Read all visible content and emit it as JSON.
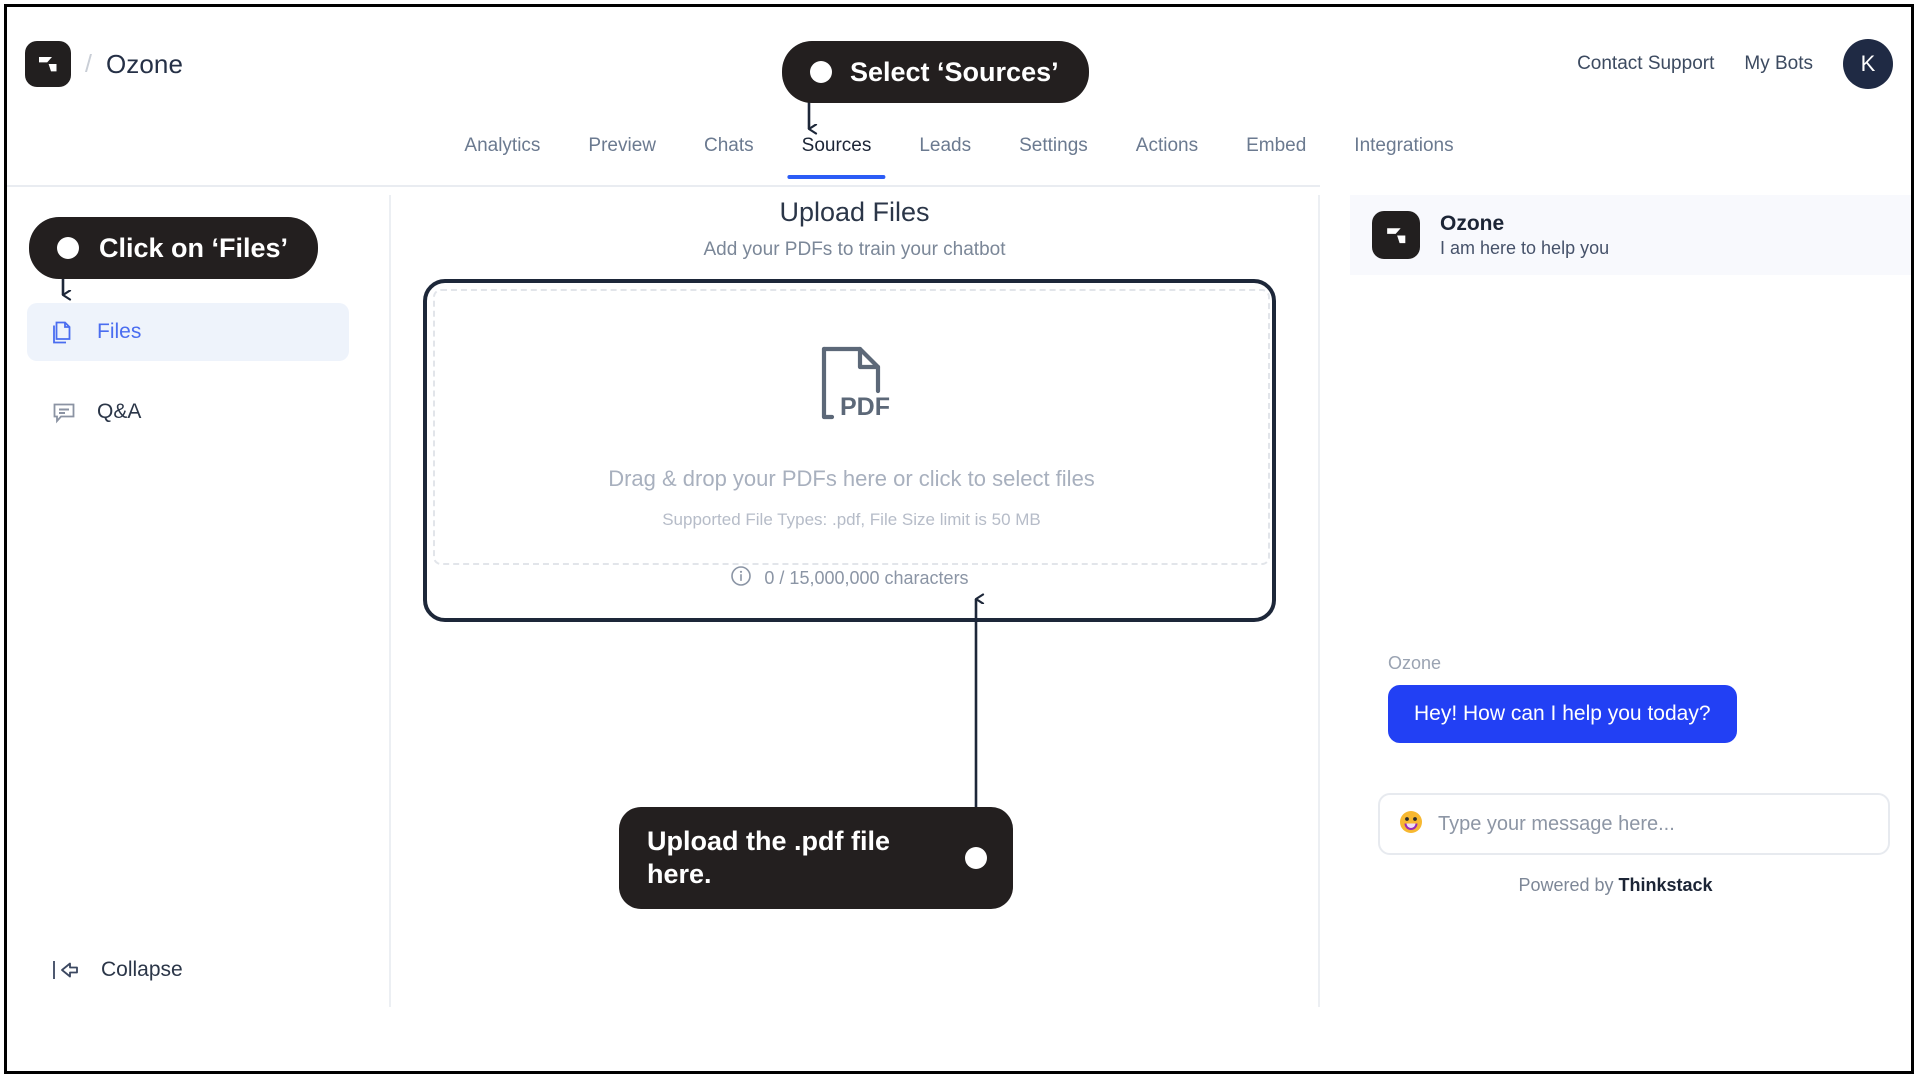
{
  "header": {
    "brand_name": "Ozone",
    "separator": "/",
    "logo_icon": "thinkstack-logo-icon",
    "links": [
      {
        "label": "Contact Support",
        "name": "contact-support-link"
      },
      {
        "label": "My Bots",
        "name": "my-bots-link"
      }
    ],
    "avatar_initial": "K"
  },
  "tabs": [
    {
      "label": "Analytics",
      "active": false
    },
    {
      "label": "Preview",
      "active": false
    },
    {
      "label": "Chats",
      "active": false
    },
    {
      "label": "Sources",
      "active": true
    },
    {
      "label": "Leads",
      "active": false
    },
    {
      "label": "Settings",
      "active": false
    },
    {
      "label": "Actions",
      "active": false
    },
    {
      "label": "Embed",
      "active": false
    },
    {
      "label": "Integrations",
      "active": false
    }
  ],
  "sidebar": {
    "items": [
      {
        "label": "Files",
        "icon": "files-copy-icon",
        "active": true
      },
      {
        "label": "Q&A",
        "icon": "chat-bubble-icon",
        "active": false
      }
    ],
    "collapse_label": "Collapse",
    "collapse_icon": "collapse-left-arrow-icon"
  },
  "main": {
    "title": "Upload Files",
    "subtitle": "Add your PDFs to train your chatbot",
    "dropzone": {
      "icon": "pdf-file-icon",
      "icon_text": "PDF",
      "primary_text": "Drag & drop your PDFs here or click to select files",
      "secondary_text": "Supported File Types: .pdf, File Size limit is 50 MB"
    },
    "character_counter": {
      "icon": "info-circle-icon",
      "text": "0 / 15,000,000 characters"
    }
  },
  "chat": {
    "bot_name": "Ozone",
    "bot_tagline": "I am here to help you",
    "logo_icon": "thinkstack-logo-icon",
    "message_sender": "Ozone",
    "message_text": "Hey! How can I help you today?",
    "input_placeholder": "Type your message here...",
    "emoji_icon": "smiley-emoji-icon",
    "powered_prefix": "Powered by ",
    "powered_brand": "Thinkstack"
  },
  "annotations": [
    {
      "id": "callout-sources",
      "text": "Select ‘Sources’",
      "dot_side": "left"
    },
    {
      "id": "callout-files",
      "text": "Click on ‘Files’",
      "dot_side": "left"
    },
    {
      "id": "callout-upload",
      "text": "Upload the .pdf file here.",
      "dot_side": "right"
    }
  ],
  "colors": {
    "accent_blue": "#2b5cf6",
    "bubble_blue": "#2240f4",
    "callout_dark": "#231f1f",
    "sidebar_active_bg": "#eef3fb",
    "sidebar_active_text": "#4a6df0"
  }
}
